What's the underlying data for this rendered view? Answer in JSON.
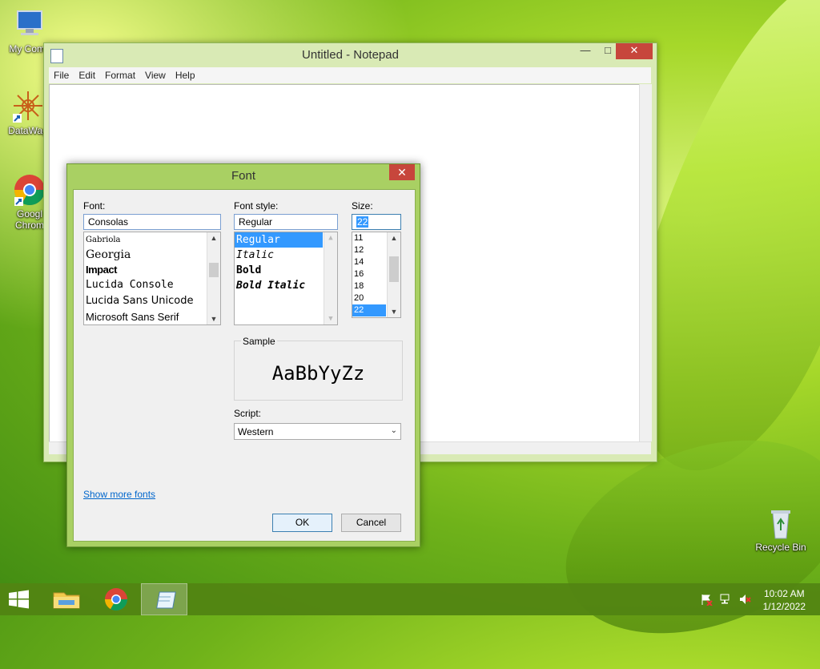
{
  "desktop": {
    "icons": [
      {
        "label": "My Comp"
      },
      {
        "label": "DataWag"
      },
      {
        "label": "Googl Chrom"
      },
      {
        "label": "Recycle Bin"
      }
    ]
  },
  "notepad": {
    "title": "Untitled - Notepad",
    "menu": [
      "File",
      "Edit",
      "Format",
      "View",
      "Help"
    ],
    "controls": {
      "minimize": "—",
      "maximize": "□",
      "close": "✕"
    }
  },
  "font_dialog": {
    "title": "Font",
    "close": "✕",
    "font": {
      "label": "Font:",
      "value": "Consolas",
      "items": [
        "Gabriola",
        "Georgia",
        "Impact",
        "Lucida Console",
        "Lucida Sans Unicode",
        "Microsoft Sans Serif"
      ]
    },
    "style": {
      "label": "Font style:",
      "value": "Regular",
      "items": [
        "Regular",
        "Italic",
        "Bold",
        "Bold Italic"
      ],
      "selected": "Regular"
    },
    "size": {
      "label": "Size:",
      "value": "22",
      "items": [
        "11",
        "12",
        "14",
        "16",
        "18",
        "20",
        "22"
      ],
      "selected": "22"
    },
    "sample": {
      "label": "Sample",
      "text": "AaBbYyZz"
    },
    "script": {
      "label": "Script:",
      "value": "Western"
    },
    "show_more_fonts": "Show more fonts",
    "ok": "OK",
    "cancel": "Cancel"
  },
  "taskbar": {
    "clock_time": "10:02 AM",
    "clock_date": "1/12/2022"
  }
}
